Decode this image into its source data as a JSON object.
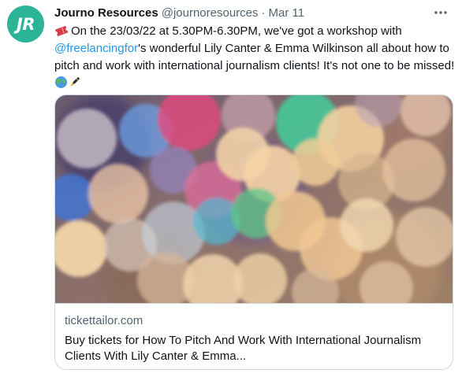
{
  "tweet": {
    "avatar_initials": "JR",
    "author_name": "Journo Resources",
    "author_handle": "@journoresources",
    "separator": "·",
    "timestamp": "Mar 11",
    "more_icon": "more-horizontal-icon",
    "text": {
      "part1": "On the 23/03/22 at 5.30PM-6.30PM, we've got a workshop with ",
      "mention": "@freelancingfor",
      "part2": "'s wonderful Lily Canter & Emma Wilkinson all about how to pitch and work with international journalism clients! It's not one to be missed! "
    },
    "icons": {
      "lead": "ticket-icon",
      "trail": [
        "globe-icon",
        "pen-icon"
      ]
    }
  },
  "card": {
    "image_desc": "bokeh-lights-image",
    "domain": "tickettailor.com",
    "title": "Buy tickets for How To Pitch And Work With International Journalism Clients With Lily Canter & Emma..."
  },
  "colors": {
    "avatar_bg": "#2bb497",
    "link": "#1d9bf0",
    "secondary_text": "#536471",
    "border": "#cfd9de"
  }
}
